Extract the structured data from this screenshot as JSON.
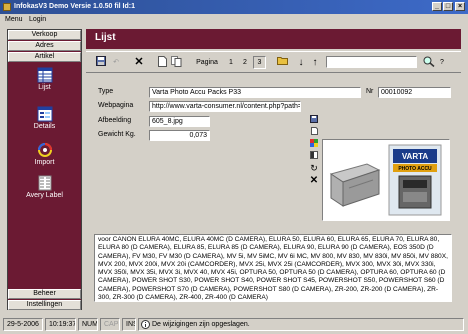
{
  "window": {
    "title": "InfokasV3 Demo  Versie 1.0.50 fil Id:1"
  },
  "menu": {
    "items": [
      "Menu",
      "Login"
    ]
  },
  "sidebar": {
    "top_tabs": [
      "Verkoop",
      "Adres",
      "Artikel"
    ],
    "icons": [
      {
        "label": "Lijst",
        "icon": "list-grid-icon"
      },
      {
        "label": "Details",
        "icon": "details-form-icon"
      },
      {
        "label": "Import",
        "icon": "import-swirl-icon"
      },
      {
        "label": "Avery Label",
        "icon": "label-sheet-icon"
      }
    ],
    "bottom_tabs": [
      "Beheer",
      "Instellingen"
    ],
    "colors": {
      "panel": "#6b1a33"
    }
  },
  "main": {
    "header": "Lijst",
    "toolbar": {
      "pagina_label": "Pagina",
      "pages": [
        "1",
        "2",
        "3"
      ],
      "active_page": "3",
      "search_value": ""
    },
    "form": {
      "type_label": "Type",
      "type_value": "Varta Photo Accu Packs P33",
      "nr_label": "Nr",
      "nr_value": "00010092",
      "webpagina_label": "Webpagina",
      "webpagina_value": "http://www.varta-consumer.nl/content.php?path=/",
      "afbeelding_label": "Afbeelding",
      "afbeelding_value": "605_8.jpg",
      "gewicht_label": "Gewicht Kg.",
      "gewicht_value": "0,073"
    },
    "description": "voor CANON ELURA 40MC, ELURA 40MC (D CAMERA), ELURA 50, ELURA 60, ELURA 65, ELURA 70, ELURA 80, ELURA 80 (D CAMERA), ELURA 85, ELURA 85 (D CAMERA), ELURA 90, ELURA 90 (D CAMERA), EOS 350D (D CAMERA), FV M30, FV M30 (D CAMERA), MV 5i, MV 5iMC, MV 6i MC, MV 800, MV 830, MV 830i, MV 850i, MV 880X, MVX 200, MVX 200i, MVX 20i (CAMCORDER), MVX 25i, MVX 25i (CAMCORDER), MVX 300, MVX 30i, MVX 330i, MVX 350i, MVX 35i, MVX 3i, MVX 40, MVX 45i, OPTURA 50, OPTURA 50 (D CAMERA), OPTURA 60, OPTURA 60 (D CAMERA), POWER SHOT S30, POWER SHOT S40, POWER SHOT S45, POWERSHOT S50, POWERSHOT S60 (D CAMERA), POWERSHOT S70 (D CAMERA), POWERSHOT S80 (D CAMERA), ZR-200, ZR-200 (D CAMERA), ZR-300, ZR-300 (D CAMERA), ZR-400, ZR-400 (D CAMERA)",
    "image": {
      "brand_text": "VARTA",
      "product_text": "PHOTO ACCU"
    }
  },
  "status": {
    "date": "29-5-2006",
    "time": "10:19:37",
    "num": "NUM",
    "caps": "CAPS",
    "ins": "INS",
    "message": "De wijzigingen zijn opgeslagen."
  }
}
